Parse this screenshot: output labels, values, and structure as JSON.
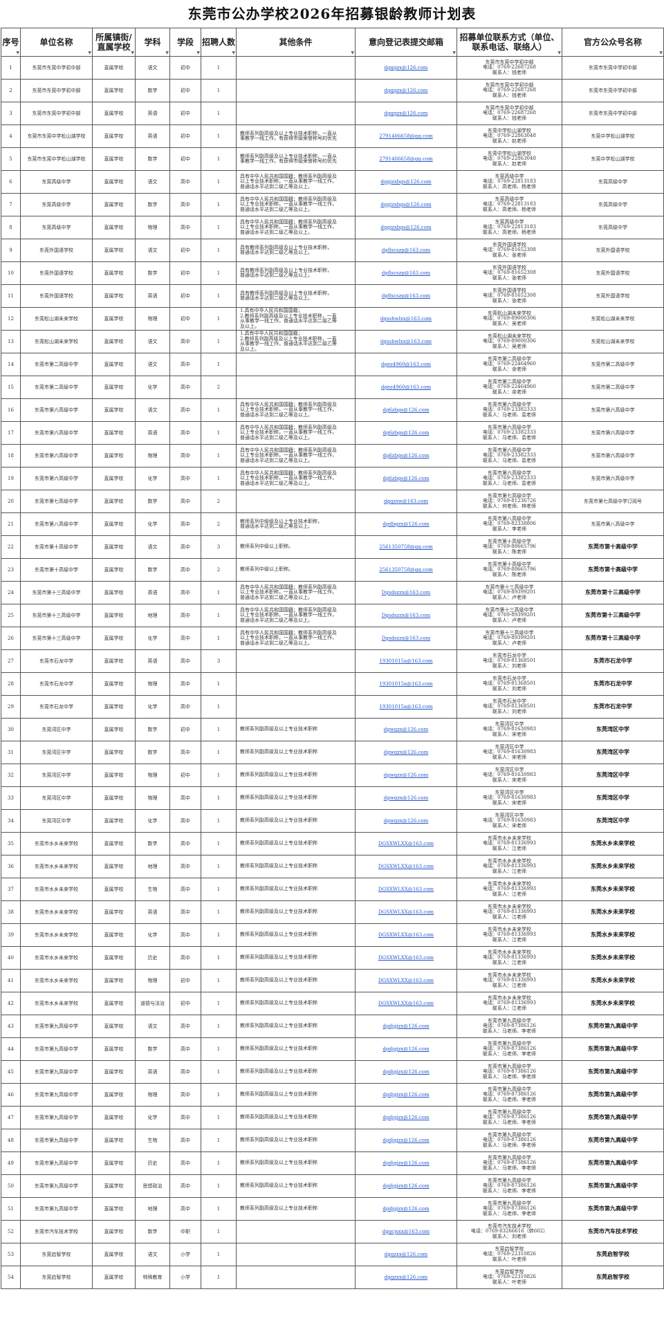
{
  "title": "东莞市公办学校2026年招募银龄教师计划表",
  "headers": [
    "序号",
    "单位名称",
    "所属镇街/直属学校",
    "学科",
    "学段",
    "招聘人数",
    "其他条件",
    "意向登记表提交邮箱",
    "招募单位联系方式（单位、联系电话、联络人）",
    "官方公众号名称"
  ],
  "rows": [
    {
      "no": "1",
      "unit": "东莞市东莞中学初中部",
      "belong": "直属学校",
      "subject": "语文",
      "stage": "初中",
      "num": "1",
      "cond": "",
      "email": "dgqgzx@126.com",
      "contact": "东莞市东莞中学初中部\n电话：0769-22687268\n联系人：钱老师",
      "acct": "东莞市东莞中学初中部",
      "bold": false
    },
    {
      "no": "2",
      "unit": "东莞市东莞中学初中部",
      "belong": "直属学校",
      "subject": "数学",
      "stage": "初中",
      "num": "1",
      "cond": "",
      "email": "dgqgzx@126.com",
      "contact": "东莞市东莞中学初中部\n电话：0769-22687268\n联系人：钱老师",
      "acct": "东莞市东莞中学初中部",
      "bold": false
    },
    {
      "no": "3",
      "unit": "东莞市东莞中学初中部",
      "belong": "直属学校",
      "subject": "英语",
      "stage": "初中",
      "num": "1",
      "cond": "",
      "email": "dgqgzx@126.com",
      "contact": "东莞市东莞中学初中部\n电话：0769-22687268\n联系人：钱老师",
      "acct": "东莞市东莞中学初中部",
      "bold": false
    },
    {
      "no": "4",
      "unit": "东莞市东莞中学松山湖学校",
      "belong": "直属学校",
      "subject": "英语",
      "stage": "初中",
      "num": "1",
      "cond": "教师系列副高级及以上专业技术职称，一直从\n事教学一线工作，有获得市级荣誉称号的优先",
      "email": "2791406658@qq.com",
      "contact": "东莞中学松山湖学校\n电话：0769-22863048\n联系人：赵老师",
      "acct": "东莞中学松山湖学校",
      "bold": false
    },
    {
      "no": "5",
      "unit": "东莞市东莞中学松山湖学校",
      "belong": "直属学校",
      "subject": "数学",
      "stage": "初中",
      "num": "1",
      "cond": "教师系列副高级及以上专业技术职称，一直从\n事教学一线工作，有获得市级荣誉称号的优先",
      "email": "2791406658@qq.com",
      "contact": "东莞中学松山湖学校\n电话：0769-22863048\n联系人：赵老师",
      "acct": "东莞中学松山湖学校",
      "bold": false
    },
    {
      "no": "6",
      "unit": "东莞高级中学",
      "belong": "直属学校",
      "subject": "语文",
      "stage": "高中",
      "num": "1",
      "cond": "具有中华人民共和国国籍；教师系列副高级及\n以上专业技术职称，一直从事教学一线工作，\n普通话水平达到二级乙等及以上。",
      "email": "dggjzxbgs@126.com",
      "contact": "东莞高级中学\n电话：0769-22813183\n联系人：高老师、杨老师",
      "acct": "东莞高级中学",
      "bold": false
    },
    {
      "no": "7",
      "unit": "东莞高级中学",
      "belong": "直属学校",
      "subject": "数学",
      "stage": "高中",
      "num": "1",
      "cond": "具有中华人民共和国国籍；教师系列副高级及\n以上专业技术职称，一直从事教学一线工作，\n普通话水平达到二级乙等及以上。",
      "email": "dggjzxbgs@126.com",
      "contact": "东莞高级中学\n电话：0769-22813183\n联系人：高老师、杨老师",
      "acct": "东莞高级中学",
      "bold": false
    },
    {
      "no": "8",
      "unit": "东莞高级中学",
      "belong": "直属学校",
      "subject": "物理",
      "stage": "高中",
      "num": "1",
      "cond": "具有中华人民共和国国籍；教师系列副高级及\n以上专业技术职称，一直从事教学一线工作，\n普通话水平达到二级乙等及以上。",
      "email": "dggjzxbgs@126.com",
      "contact": "东莞高级中学\n电话：0769-22813183\n联系人：高老师、杨老师",
      "acct": "东莞高级中学",
      "bold": false
    },
    {
      "no": "9",
      "unit": "东莞外国语学校",
      "belong": "直属学校",
      "subject": "语文",
      "stage": "初中",
      "num": "1",
      "cond": "具有教师系列副高级及以上专业技术职称，\n普通话水平达到二级乙等及以上。",
      "email": "dgflscszp@163.com",
      "contact": "东莞外国语学校\n电话：0769-81652308\n联系人：张老师",
      "acct": "东莞外国语学校",
      "bold": false
    },
    {
      "no": "10",
      "unit": "东莞外国语学校",
      "belong": "直属学校",
      "subject": "数学",
      "stage": "初中",
      "num": "1",
      "cond": "具有教师系列副高级及以上专业技术职称，\n普通话水平达到二级乙等及以上。",
      "email": "dgflscszp@163.com",
      "contact": "东莞外国语学校\n电话：0769-81652308\n联系人：张老师",
      "acct": "东莞外国语学校",
      "bold": false
    },
    {
      "no": "11",
      "unit": "东莞外国语学校",
      "belong": "直属学校",
      "subject": "英语",
      "stage": "初中",
      "num": "1",
      "cond": "具有教师系列副高级及以上专业技术职称，\n普通话水平达到二级乙等及以上。",
      "email": "dgflscszp@163.com",
      "contact": "东莞外国语学校\n电话：0769-81652308\n联系人：张老师",
      "acct": "东莞外国语学校",
      "bold": false
    },
    {
      "no": "12",
      "unit": "东莞松山湖未来学校",
      "belong": "直属学校",
      "subject": "物理",
      "stage": "初中",
      "num": "1",
      "cond": "1.具有中华人民共和国国籍；\n2.教师系列副高级及以上专业技术职称，一直\n从事教学一线工作，普通话水平达到二级乙等\n及以上。",
      "email": "dgsshwlxx@163.com",
      "contact": "东莞松山湖未来学校\n电话：0769-89000306\n联系人：吴老师",
      "acct": "东莞松山湖未来学校",
      "bold": false
    },
    {
      "no": "13",
      "unit": "东莞松山湖未来学校",
      "belong": "直属学校",
      "subject": "语文",
      "stage": "高中",
      "num": "1",
      "cond": "1.具有中华人民共和国国籍；\n2.教师系列副高级及以上专业技术职称，一直\n从事教学一线工作，普通话水平达到二级乙等\n及以上。",
      "email": "dgsshwlxx@163.com",
      "contact": "东莞松山湖未来学校\n电话：0769-89000306\n联系人：吴老师",
      "acct": "东莞松山湖未来学校",
      "bold": false
    },
    {
      "no": "14",
      "unit": "东莞市第二高级中学",
      "belong": "直属学校",
      "subject": "语文",
      "stage": "高中",
      "num": "1",
      "cond": "",
      "email": "dgez4960@163.com",
      "contact": "东莞市第二高级中学\n电话：0769-22464960\n联系人：余老师",
      "acct": "东莞市第二高级中学",
      "bold": false
    },
    {
      "no": "15",
      "unit": "东莞市第二高级中学",
      "belong": "直属学校",
      "subject": "化学",
      "stage": "高中",
      "num": "2",
      "cond": "",
      "email": "dgez4960@163.com",
      "contact": "东莞市第二高级中学\n电话：0769-22464960\n联系人：余老师",
      "acct": "东莞市第二高级中学",
      "bold": false
    },
    {
      "no": "16",
      "unit": "东莞市第六高级中学",
      "belong": "直属学校",
      "subject": "语文",
      "stage": "高中",
      "num": "1",
      "cond": "具有中华人民共和国国籍；教师系列副高级及\n以上专业技术职称，一直从事教学一线工作，\n普通话水平达到二级乙等及以上。",
      "email": "dg6zbgs@126.com",
      "contact": "东莞市第六高级中学\n电话：0769-23382333\n联系人：马老师、袁老师",
      "acct": "东莞市第六高级中学",
      "bold": false
    },
    {
      "no": "17",
      "unit": "东莞市第六高级中学",
      "belong": "直属学校",
      "subject": "英语",
      "stage": "高中",
      "num": "1",
      "cond": "具有中华人民共和国国籍；教师系列副高级及\n以上专业技术职称，一直从事教学一线工作，\n普通话水平达到二级乙等及以上。",
      "email": "dg6zbgs@126.com",
      "contact": "东莞市第六高级中学\n电话：0769-23382333\n联系人：马老师、袁老师",
      "acct": "东莞市第六高级中学",
      "bold": false
    },
    {
      "no": "18",
      "unit": "东莞市第六高级中学",
      "belong": "直属学校",
      "subject": "物理",
      "stage": "高中",
      "num": "1",
      "cond": "具有中华人民共和国国籍；教师系列副高级及\n以上专业技术职称，一直从事教学一线工作，\n普通话水平达到二级乙等及以上。",
      "email": "dg6zbgs@126.com",
      "contact": "东莞市第六高级中学\n电话：0769-23382333\n联系人：马老师、袁老师",
      "acct": "东莞市第六高级中学",
      "bold": false
    },
    {
      "no": "19",
      "unit": "东莞市第六高级中学",
      "belong": "直属学校",
      "subject": "化学",
      "stage": "高中",
      "num": "1",
      "cond": "具有中华人民共和国国籍；教师系列副高级及\n以上专业技术职称，一直从事教学一线工作，\n普通话水平达到二级乙等及以上。",
      "email": "dg6zbgs@126.com",
      "contact": "东莞市第六高级中学\n电话：0769-23382333\n联系人：马老师、袁老师",
      "acct": "东莞市第六高级中学",
      "bold": false
    },
    {
      "no": "20",
      "unit": "东莞市第七高级中学",
      "belong": "直属学校",
      "subject": "数学",
      "stage": "高中",
      "num": "2",
      "cond": "",
      "email": "dgqzsw@163.com",
      "contact": "东莞市第七高级中学\n电话：0769-81236726\n联系人：何老师、林老师",
      "acct": "东莞市第七高级中学订阅号",
      "bold": false
    },
    {
      "no": "21",
      "unit": "东莞市第八高级中学",
      "belong": "直属学校",
      "subject": "化学",
      "stage": "高中",
      "num": "2",
      "cond": "教师系列中级级及以上专业技术职称，\n普通话水平达到二级乙等及以上。",
      "email": "dgdbgzx@126.com",
      "contact": "东莞市第八高级中学\n电话：0769-82338806\n联系人：李老师",
      "acct": "东莞市第八高级中学",
      "bold": false
    },
    {
      "no": "22",
      "unit": "东莞市第十高级中学",
      "belong": "直属学校",
      "subject": "语文",
      "stage": "高中",
      "num": "3",
      "cond": "教师系列中级以上职称。",
      "email": "2561350758@qq.com",
      "contact": "东莞市第十高级中学\n电话：0769-88665796\n联系人：陈老师",
      "acct": "东莞市第十高级中学",
      "bold": true
    },
    {
      "no": "23",
      "unit": "东莞市第十高级中学",
      "belong": "直属学校",
      "subject": "数学",
      "stage": "高中",
      "num": "2",
      "cond": "教师系列中级以上职称。",
      "email": "2561350758@qq.com",
      "contact": "东莞市第十高级中学\n电话：0769-88665796\n联系人：陈老师",
      "acct": "东莞市第十高级中学",
      "bold": true
    },
    {
      "no": "24",
      "unit": "东莞市第十三高级中学",
      "belong": "直属学校",
      "subject": "英语",
      "stage": "高中",
      "num": "1",
      "cond": "具有中华人民共和国国籍；教师系列副高级及\n以上专业技术职称，一直从事教学一线工作，\n普通话水平达到二级乙等及以上。",
      "email": "Dgsdszzx@163.com",
      "contact": "东莞市第十三高级中学\n电话：0769-89399201\n联系人：卢老师",
      "acct": "东莞市第十三高级中学",
      "bold": true
    },
    {
      "no": "25",
      "unit": "东莞市第十三高级中学",
      "belong": "直属学校",
      "subject": "地理",
      "stage": "高中",
      "num": "1",
      "cond": "具有中华人民共和国国籍；教师系列副高级及\n以上专业技术职称，一直从事教学一线工作，\n普通话水平达到二级乙等及以上。",
      "email": "Dgsdszzx@163.com",
      "contact": "东莞市第十三高级中学\n电话：0769-89399201\n联系人：卢老师",
      "acct": "东莞市第十三高级中学",
      "bold": true
    },
    {
      "no": "26",
      "unit": "东莞市第十三高级中学",
      "belong": "直属学校",
      "subject": "化学",
      "stage": "高中",
      "num": "1",
      "cond": "具有中华人民共和国国籍；教师系列副高级及\n以上专业技术职称，一直从事教学一线工作，\n普通话水平达到二级乙等及以上。",
      "email": "Dgsdszzx@163.com",
      "contact": "东莞市第十三高级中学\n电话：0769-89399201\n联系人：卢老师",
      "acct": "东莞市第十三高级中学",
      "bold": true
    },
    {
      "no": "27",
      "unit": "东莞市石龙中学",
      "belong": "直属学校",
      "subject": "英语",
      "stage": "高中",
      "num": "3",
      "cond": "",
      "email": "19301015a@163.com",
      "contact": "东莞市石龙中学\n电话：0769-81368501\n联系人：刘老师",
      "acct": "东莞市石龙中学",
      "bold": true
    },
    {
      "no": "28",
      "unit": "东莞市石龙中学",
      "belong": "直属学校",
      "subject": "物理",
      "stage": "高中",
      "num": "1",
      "cond": "",
      "email": "19301015a@163.com",
      "contact": "东莞市石龙中学\n电话：0769-81368501\n联系人：刘老师",
      "acct": "东莞市石龙中学",
      "bold": true
    },
    {
      "no": "29",
      "unit": "东莞市石龙中学",
      "belong": "直属学校",
      "subject": "化学",
      "stage": "高中",
      "num": "1",
      "cond": "",
      "email": "19301015a@163.com",
      "contact": "东莞市石龙中学\n电话：0769-81368501\n联系人：刘老师",
      "acct": "东莞市石龙中学",
      "bold": true
    },
    {
      "no": "30",
      "unit": "东莞湾区中学",
      "belong": "直属学校",
      "subject": "数学",
      "stage": "初中",
      "num": "1",
      "cond": "教师系列副高级及以上专业技术职称",
      "email": "dgwqzx@126.com",
      "contact": "东莞湾区中学\n电话：0769-81630983\n联系人：宋老师",
      "acct": "东莞湾区中学",
      "bold": true
    },
    {
      "no": "31",
      "unit": "东莞湾区中学",
      "belong": "直属学校",
      "subject": "数学",
      "stage": "高中",
      "num": "1",
      "cond": "教师系列副高级及以上专业技术职称",
      "email": "dgwqzx@126.com",
      "contact": "东莞湾区中学\n电话：0769-81630983\n联系人：宋老师",
      "acct": "东莞湾区中学",
      "bold": true
    },
    {
      "no": "32",
      "unit": "东莞湾区中学",
      "belong": "直属学校",
      "subject": "物理",
      "stage": "初中",
      "num": "1",
      "cond": "教师系列副高级及以上专业技术职称",
      "email": "dgwqzx@126.com",
      "contact": "东莞湾区中学\n电话：0769-81630983\n联系人：宋老师",
      "acct": "东莞湾区中学",
      "bold": true
    },
    {
      "no": "33",
      "unit": "东莞湾区中学",
      "belong": "直属学校",
      "subject": "物理",
      "stage": "高中",
      "num": "1",
      "cond": "教师系列副高级及以上专业技术职称",
      "email": "dgwqzx@126.com",
      "contact": "东莞湾区中学\n电话：0769-81630983\n联系人：宋老师",
      "acct": "东莞湾区中学",
      "bold": true
    },
    {
      "no": "34",
      "unit": "东莞湾区中学",
      "belong": "直属学校",
      "subject": "化学",
      "stage": "高中",
      "num": "1",
      "cond": "教师系列副高级及以上专业技术职称",
      "email": "dgwqzx@126.com",
      "contact": "东莞湾区中学\n电话：0769-81630983\n联系人：宋老师",
      "acct": "东莞湾区中学",
      "bold": true
    },
    {
      "no": "35",
      "unit": "东莞市水乡未来学校",
      "belong": "直属学校",
      "subject": "数学",
      "stage": "高中",
      "num": "1",
      "cond": "教师系列副高级及以上专业技术职称",
      "email": "DGSXWLXX@163.com",
      "contact": "东莞市水乡未来学校\n电话：0769-81336993\n联系人：江老师",
      "acct": "东莞水乡未来学校",
      "bold": true
    },
    {
      "no": "36",
      "unit": "东莞市水乡未来学校",
      "belong": "直属学校",
      "subject": "地理",
      "stage": "高中",
      "num": "1",
      "cond": "教师系列副高级及以上专业技术职称",
      "email": "DGSXWLXX@163.com",
      "contact": "东莞市水乡未来学校\n电话：0769-81336993\n联系人：江老师",
      "acct": "东莞水乡未来学校",
      "bold": true
    },
    {
      "no": "37",
      "unit": "东莞市水乡未来学校",
      "belong": "直属学校",
      "subject": "生物",
      "stage": "高中",
      "num": "1",
      "cond": "教师系列副高级及以上专业技术职称",
      "email": "DGSXWLXX@163.com",
      "contact": "东莞市水乡未来学校\n电话：0769-81336993\n联系人：江老师",
      "acct": "东莞水乡未来学校",
      "bold": true
    },
    {
      "no": "38",
      "unit": "东莞市水乡未来学校",
      "belong": "直属学校",
      "subject": "英语",
      "stage": "高中",
      "num": "1",
      "cond": "教师系列副高级及以上专业技术职称",
      "email": "DGSXWLXX@163.com",
      "contact": "东莞市水乡未来学校\n电话：0769-81336993\n联系人：江老师",
      "acct": "东莞水乡未来学校",
      "bold": true
    },
    {
      "no": "39",
      "unit": "东莞市水乡未来学校",
      "belong": "直属学校",
      "subject": "化学",
      "stage": "高中",
      "num": "1",
      "cond": "教师系列副高级及以上专业技术职称",
      "email": "DGSXWLXX@163.com",
      "contact": "东莞市水乡未来学校\n电话：0769-81336993\n联系人：江老师",
      "acct": "东莞水乡未来学校",
      "bold": true
    },
    {
      "no": "40",
      "unit": "东莞市水乡未来学校",
      "belong": "直属学校",
      "subject": "历史",
      "stage": "高中",
      "num": "1",
      "cond": "教师系列副高级及以上专业技术职称",
      "email": "DGSXWLXX@163.com",
      "contact": "东莞市水乡未来学校\n电话：0769-81336993\n联系人：江老师",
      "acct": "东莞水乡未来学校",
      "bold": true
    },
    {
      "no": "41",
      "unit": "东莞市水乡未来学校",
      "belong": "直属学校",
      "subject": "物理",
      "stage": "初中",
      "num": "1",
      "cond": "教师系列副高级及以上专业技术职称",
      "email": "DGSXWLXX@163.com",
      "contact": "东莞市水乡未来学校\n电话：0769-81336993\n联系人：江老师",
      "acct": "东莞水乡未来学校",
      "bold": true
    },
    {
      "no": "42",
      "unit": "东莞市水乡未来学校",
      "belong": "直属学校",
      "subject": "道德与法治",
      "stage": "初中",
      "num": "1",
      "cond": "教师系列副高级及以上专业技术职称",
      "email": "DGSXWLXX@163.com",
      "contact": "东莞市水乡未来学校\n电话：0769-81336993\n联系人：江老师",
      "acct": "东莞水乡未来学校",
      "bold": true
    },
    {
      "no": "43",
      "unit": "东莞市第九高级中学",
      "belong": "直属学校",
      "subject": "语文",
      "stage": "高中",
      "num": "1",
      "cond": "教师系列副高级及以上专业技术职称",
      "email": "dgdjgjzx@126.com",
      "contact": "东莞市第九高级中学\n电话：0769-87386126\n联系人：马老师、李老师",
      "acct": "东莞市第九高级中学",
      "bold": true
    },
    {
      "no": "44",
      "unit": "东莞市第九高级中学",
      "belong": "直属学校",
      "subject": "数学",
      "stage": "高中",
      "num": "1",
      "cond": "教师系列副高级及以上专业技术职称",
      "email": "dgdjgjzx@126.com",
      "contact": "东莞市第九高级中学\n电话：0769-87386126\n联系人：马老师、李老师",
      "acct": "东莞市第九高级中学",
      "bold": true
    },
    {
      "no": "45",
      "unit": "东莞市第九高级中学",
      "belong": "直属学校",
      "subject": "英语",
      "stage": "高中",
      "num": "1",
      "cond": "教师系列副高级及以上专业技术职称",
      "email": "dgdjgjzx@126.com",
      "contact": "东莞市第九高级中学\n电话：0769-87386126\n联系人：马老师、李老师",
      "acct": "东莞市第九高级中学",
      "bold": true
    },
    {
      "no": "46",
      "unit": "东莞市第九高级中学",
      "belong": "直属学校",
      "subject": "物理",
      "stage": "高中",
      "num": "1",
      "cond": "教师系列副高级及以上专业技术职称",
      "email": "dgdjgjzx@126.com",
      "contact": "东莞市第九高级中学\n电话：0769-87386126\n联系人：马老师、李老师",
      "acct": "东莞市第九高级中学",
      "bold": true
    },
    {
      "no": "47",
      "unit": "东莞市第九高级中学",
      "belong": "直属学校",
      "subject": "化学",
      "stage": "高中",
      "num": "1",
      "cond": "教师系列副高级及以上专业技术职称",
      "email": "dgdjgjzx@126.com",
      "contact": "东莞市第九高级中学\n电话：0769-87386126\n联系人：马老师、李老师",
      "acct": "东莞市第九高级中学",
      "bold": true
    },
    {
      "no": "48",
      "unit": "东莞市第九高级中学",
      "belong": "直属学校",
      "subject": "生物",
      "stage": "高中",
      "num": "1",
      "cond": "教师系列副高级及以上专业技术职称",
      "email": "dgdjgjzx@126.com",
      "contact": "东莞市第九高级中学\n电话：0769-87386126\n联系人：马老师、李老师",
      "acct": "东莞市第九高级中学",
      "bold": true
    },
    {
      "no": "49",
      "unit": "东莞市第九高级中学",
      "belong": "直属学校",
      "subject": "历史",
      "stage": "高中",
      "num": "1",
      "cond": "教师系列副高级及以上专业技术职称",
      "email": "dgdjgjzx@126.com",
      "contact": "东莞市第九高级中学\n电话：0769-87386126\n联系人：马老师、李老师",
      "acct": "东莞市第九高级中学",
      "bold": true
    },
    {
      "no": "50",
      "unit": "东莞市第九高级中学",
      "belong": "直属学校",
      "subject": "思想政治",
      "stage": "高中",
      "num": "1",
      "cond": "教师系列副高级及以上专业技术职称",
      "email": "dgdjgjzx@126.com",
      "contact": "东莞市第九高级中学\n电话：0769-87386126\n联系人：马老师、李老师",
      "acct": "东莞市第九高级中学",
      "bold": true
    },
    {
      "no": "51",
      "unit": "东莞市第九高级中学",
      "belong": "直属学校",
      "subject": "地理",
      "stage": "高中",
      "num": "1",
      "cond": "教师系列副高级及以上专业技术职称",
      "email": "dgdjgjzx@126.com",
      "contact": "东莞市第九高级中学\n电话：0769-87386126\n联系人：马老师、李老师",
      "acct": "东莞市第九高级中学",
      "bold": true
    },
    {
      "no": "52",
      "unit": "东莞市汽车技术学校",
      "belong": "直属学校",
      "subject": "数学",
      "stage": "中职",
      "num": "1",
      "cond": "",
      "email": "dgqcjsxx@163.com",
      "contact": "东莞市汽车技术学校\n电话：0769-83266616（转602）\n联系人：刘老师",
      "acct": "东莞市汽车技术学校",
      "bold": true
    },
    {
      "no": "53",
      "unit": "东莞启智学校",
      "belong": "直属学校",
      "subject": "语文",
      "stage": "小学",
      "num": "1",
      "cond": "",
      "email": "dgqzxx@126.com",
      "contact": "东莞启智学校\n电话：0769-22310826\n联系人：叶老师",
      "acct": "东莞启智学校",
      "bold": true
    },
    {
      "no": "54",
      "unit": "东莞启智学校",
      "belong": "直属学校",
      "subject": "特殊教育",
      "stage": "小学",
      "num": "1",
      "cond": "",
      "email": "dgqzxx@126.com",
      "contact": "东莞启智学校\n电话：0769-22310826\n联系人：叶老师",
      "acct": "东莞启智学校",
      "bold": true
    }
  ]
}
